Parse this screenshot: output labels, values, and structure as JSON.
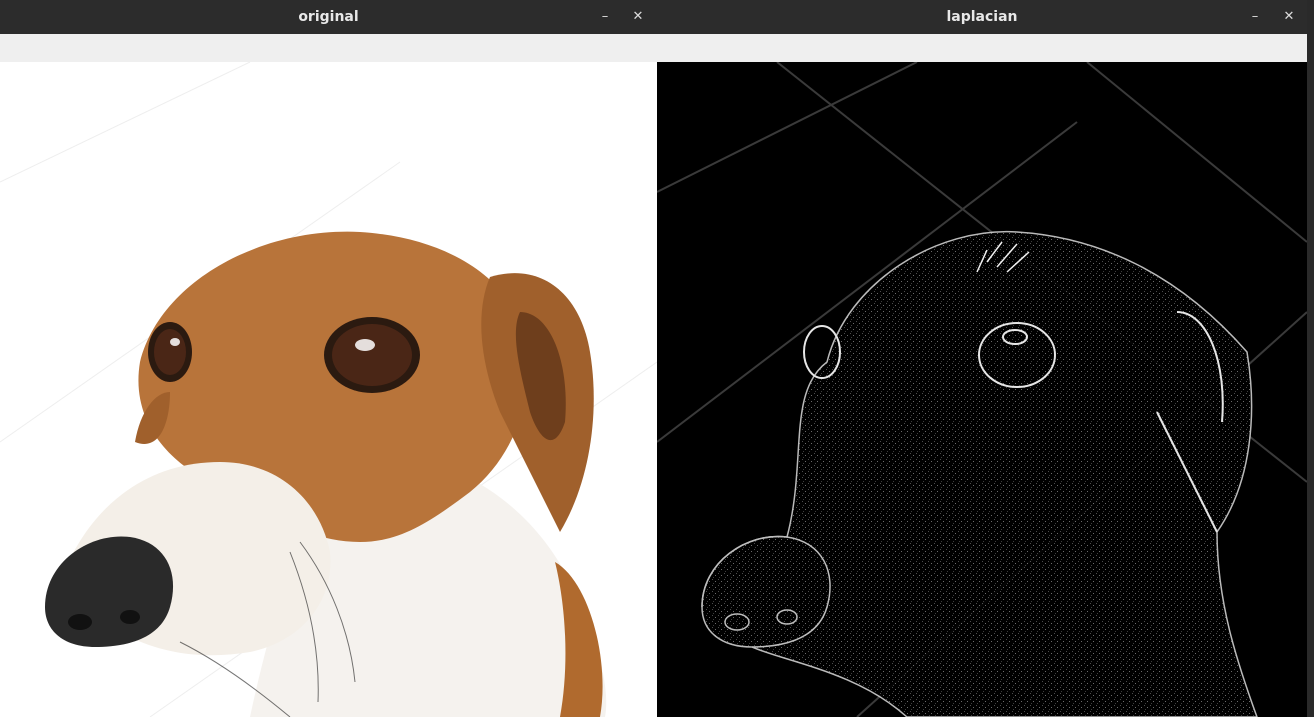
{
  "windows": [
    {
      "title": "original",
      "controls": {
        "minimize_glyph": "–",
        "close_glyph": "✕"
      },
      "image": {
        "subject": "dog-photo",
        "icon": "image-icon"
      }
    },
    {
      "title": "laplacian",
      "controls": {
        "minimize_glyph": "–",
        "close_glyph": "✕"
      },
      "image": {
        "subject": "laplacian-edge-map",
        "icon": "image-icon"
      }
    }
  ],
  "colors": {
    "titlebar": "#2c2c2c",
    "toolbar": "#efefef",
    "fur_tan": "#b8743a",
    "fur_white": "#f4efe8",
    "nose": "#2a2a2a",
    "edge_line": "#dcdcdc"
  }
}
